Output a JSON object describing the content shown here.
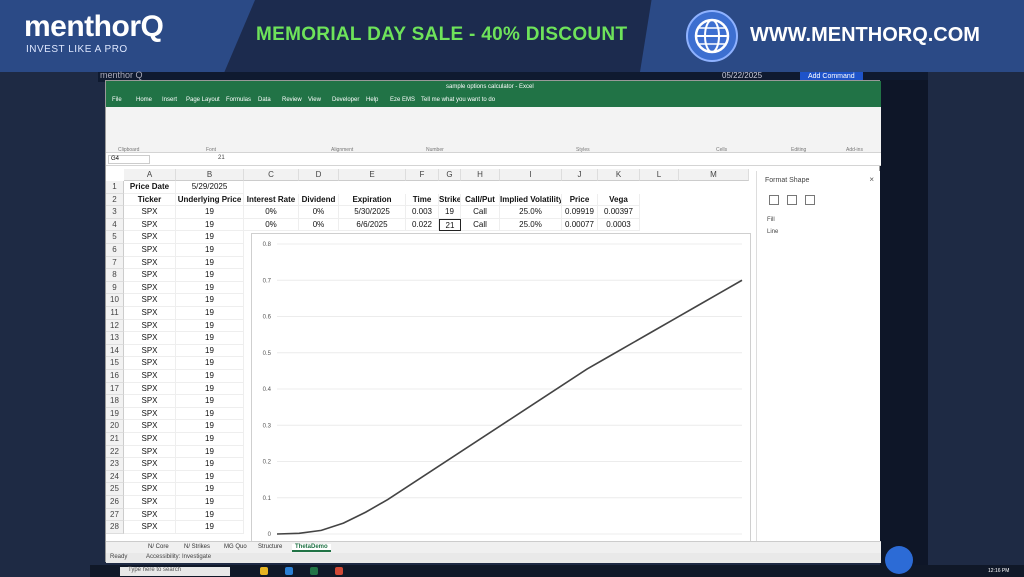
{
  "banner": {
    "logo": "menthorQ",
    "tagline": "INVEST LIKE A PRO",
    "sale": "MEMORIAL DAY SALE - 40% DISCOUNT",
    "url": "WWW.MENTHORQ.COM"
  },
  "background_app": {
    "name": "menthor Q",
    "date": "05/22/2025",
    "add_command": "Add Command"
  },
  "excel": {
    "title": "sample options calculator - Excel",
    "menu": [
      "File",
      "Home",
      "Insert",
      "Page Layout",
      "Formulas",
      "Data",
      "Review",
      "View",
      "Developer",
      "Help",
      "Eze EMS",
      "Tell me what you want to do"
    ],
    "ribbon_groups": [
      "Clipboard",
      "Font",
      "Alignment",
      "Number",
      "Styles",
      "Cells",
      "Editing",
      "Add-ins"
    ],
    "name_box": "G4",
    "formula": "21",
    "columns": [
      "A",
      "B",
      "C",
      "D",
      "E",
      "F",
      "G",
      "H",
      "I",
      "J",
      "K",
      "L",
      "M"
    ],
    "header_row": [
      "Ticker",
      "Underlying Price",
      "Interest Rate",
      "Dividend",
      "Expiration",
      "Time",
      "Strike",
      "Call/Put",
      "Implied Volatility",
      "Price",
      "Vega"
    ],
    "row1": {
      "label": "Price Date",
      "value": "5/29/2025"
    },
    "rows": [
      [
        "SPX",
        "19",
        "0%",
        "0%",
        "5/30/2025",
        "0.003",
        "19",
        "Call",
        "25.0%",
        "0.09919",
        "0.00397"
      ],
      [
        "SPX",
        "19",
        "0%",
        "0%",
        "6/6/2025",
        "0.022",
        "21",
        "Call",
        "25.0%",
        "0.00077",
        "0.0003"
      ]
    ],
    "ticker_rows": {
      "ticker": "SPX",
      "price": "19",
      "count": 24
    },
    "sheet_tabs": [
      "N/ Core",
      "N/ Strikes",
      "MG Quo",
      "Structure",
      "ThetaDemo"
    ],
    "active_tab": "ThetaDemo",
    "status": "Ready",
    "accessibility": "Accessibility: Investigate"
  },
  "format_pane": {
    "title": "Format Shape",
    "sections": [
      "Fill",
      "Line"
    ]
  },
  "chart_data": {
    "type": "line",
    "title": "",
    "xlabel": "",
    "ylabel": "",
    "ylim": [
      0,
      0.8
    ],
    "yticks": [
      "0",
      "0.1",
      "0.2",
      "0.3",
      "0.4",
      "0.5",
      "0.6",
      "0.7",
      "0.8"
    ],
    "series": [
      {
        "values": [
          0.0,
          0.002,
          0.01,
          0.03,
          0.06,
          0.095,
          0.135,
          0.175,
          0.215,
          0.255,
          0.295,
          0.335,
          0.375,
          0.415,
          0.455,
          0.49,
          0.525,
          0.56,
          0.595,
          0.63,
          0.665,
          0.7
        ],
        "color": "#444444"
      }
    ]
  },
  "taskbar": {
    "search": "Type here to search",
    "clock": "12:16 PM"
  }
}
